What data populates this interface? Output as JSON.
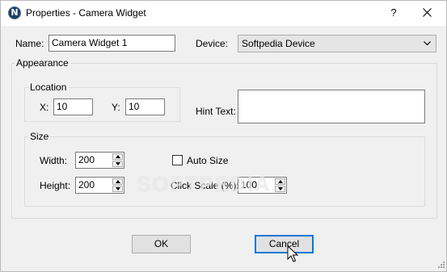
{
  "window": {
    "title": "Properties - Camera Widget",
    "app_icon_letter": "N",
    "help_label": "?"
  },
  "form": {
    "name_label": "Name:",
    "name_value": "Camera Widget 1",
    "device_label": "Device:",
    "device_value": "Softpedia Device"
  },
  "appearance": {
    "label": "Appearance",
    "location": {
      "label": "Location",
      "x_label": "X:",
      "x_value": "10",
      "y_label": "Y:",
      "y_value": "10"
    },
    "hint_label": "Hint Text:",
    "hint_value": "",
    "size": {
      "label": "Size",
      "width_label": "Width:",
      "width_value": "200",
      "height_label": "Height:",
      "height_value": "200",
      "autosize_label": "Auto Size",
      "autosize_checked": false,
      "clickscale_label": "Click Scale (%):",
      "clickscale_value": "100"
    }
  },
  "buttons": {
    "ok_label": "OK",
    "cancel_label": "Cancel"
  },
  "watermark": "SOFTPEDIA",
  "colors": {
    "dialog_bg": "#f0f0f0",
    "focus_border": "#0078d7",
    "app_icon_bg": "#1f3d63"
  }
}
